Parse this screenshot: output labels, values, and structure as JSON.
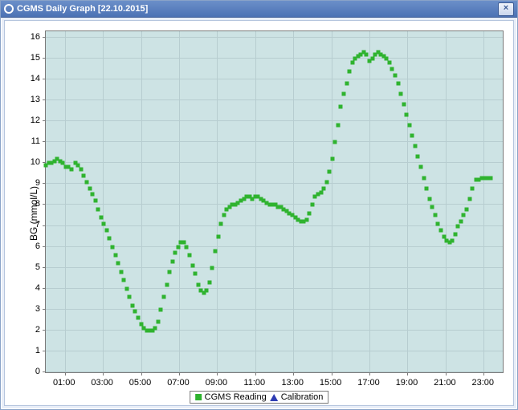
{
  "window": {
    "title": "CGMS Daily Graph [22.10.2015]",
    "close_label": "×"
  },
  "legend": {
    "series1": "CGMS Reading",
    "series2": "Calibration"
  },
  "chart_data": {
    "type": "scatter",
    "title": "",
    "xlabel": "",
    "ylabel": "BG (mmol/L)",
    "x_ticks": [
      "01:00",
      "03:00",
      "05:00",
      "07:00",
      "09:00",
      "11:00",
      "13:00",
      "15:00",
      "17:00",
      "19:00",
      "21:00",
      "23:00"
    ],
    "y_ticks": [
      0,
      1,
      2,
      3,
      4,
      5,
      6,
      7,
      8,
      9,
      10,
      11,
      12,
      13,
      14,
      15,
      16
    ],
    "xlim": [
      0,
      24
    ],
    "ylim": [
      0,
      16.3
    ],
    "series": [
      {
        "name": "CGMS Reading",
        "marker": "square",
        "color": "#2fb32f",
        "points": [
          [
            0.0,
            9.9
          ],
          [
            0.15,
            10.0
          ],
          [
            0.3,
            10.0
          ],
          [
            0.45,
            10.1
          ],
          [
            0.6,
            10.2
          ],
          [
            0.75,
            10.1
          ],
          [
            0.9,
            10.0
          ],
          [
            1.05,
            9.8
          ],
          [
            1.2,
            9.8
          ],
          [
            1.35,
            9.7
          ],
          [
            1.55,
            10.0
          ],
          [
            1.7,
            9.9
          ],
          [
            1.85,
            9.7
          ],
          [
            2.0,
            9.4
          ],
          [
            2.15,
            9.1
          ],
          [
            2.3,
            8.8
          ],
          [
            2.45,
            8.5
          ],
          [
            2.6,
            8.2
          ],
          [
            2.75,
            7.8
          ],
          [
            2.9,
            7.4
          ],
          [
            3.05,
            7.1
          ],
          [
            3.2,
            6.8
          ],
          [
            3.35,
            6.4
          ],
          [
            3.5,
            6.0
          ],
          [
            3.65,
            5.6
          ],
          [
            3.8,
            5.2
          ],
          [
            3.95,
            4.8
          ],
          [
            4.1,
            4.4
          ],
          [
            4.25,
            4.0
          ],
          [
            4.4,
            3.6
          ],
          [
            4.55,
            3.2
          ],
          [
            4.7,
            2.9
          ],
          [
            4.85,
            2.6
          ],
          [
            5.0,
            2.3
          ],
          [
            5.15,
            2.1
          ],
          [
            5.3,
            2.0
          ],
          [
            5.45,
            2.0
          ],
          [
            5.6,
            2.0
          ],
          [
            5.75,
            2.1
          ],
          [
            5.9,
            2.4
          ],
          [
            6.05,
            3.0
          ],
          [
            6.2,
            3.6
          ],
          [
            6.35,
            4.2
          ],
          [
            6.5,
            4.8
          ],
          [
            6.65,
            5.3
          ],
          [
            6.8,
            5.7
          ],
          [
            6.95,
            6.0
          ],
          [
            7.1,
            6.2
          ],
          [
            7.25,
            6.2
          ],
          [
            7.4,
            6.0
          ],
          [
            7.55,
            5.6
          ],
          [
            7.7,
            5.1
          ],
          [
            7.85,
            4.7
          ],
          [
            8.0,
            4.2
          ],
          [
            8.15,
            3.9
          ],
          [
            8.3,
            3.8
          ],
          [
            8.45,
            3.9
          ],
          [
            8.6,
            4.3
          ],
          [
            8.75,
            5.0
          ],
          [
            8.9,
            5.8
          ],
          [
            9.05,
            6.5
          ],
          [
            9.2,
            7.1
          ],
          [
            9.35,
            7.5
          ],
          [
            9.5,
            7.8
          ],
          [
            9.65,
            7.9
          ],
          [
            9.8,
            8.0
          ],
          [
            9.95,
            8.0
          ],
          [
            10.1,
            8.1
          ],
          [
            10.25,
            8.2
          ],
          [
            10.4,
            8.3
          ],
          [
            10.55,
            8.4
          ],
          [
            10.7,
            8.4
          ],
          [
            10.85,
            8.3
          ],
          [
            11.0,
            8.4
          ],
          [
            11.15,
            8.4
          ],
          [
            11.3,
            8.3
          ],
          [
            11.45,
            8.2
          ],
          [
            11.6,
            8.1
          ],
          [
            11.75,
            8.0
          ],
          [
            11.9,
            8.0
          ],
          [
            12.05,
            8.0
          ],
          [
            12.2,
            7.9
          ],
          [
            12.35,
            7.9
          ],
          [
            12.5,
            7.8
          ],
          [
            12.65,
            7.7
          ],
          [
            12.8,
            7.6
          ],
          [
            12.95,
            7.5
          ],
          [
            13.1,
            7.4
          ],
          [
            13.25,
            7.3
          ],
          [
            13.4,
            7.2
          ],
          [
            13.55,
            7.2
          ],
          [
            13.7,
            7.3
          ],
          [
            13.85,
            7.6
          ],
          [
            14.0,
            8.0
          ],
          [
            14.15,
            8.4
          ],
          [
            14.3,
            8.5
          ],
          [
            14.45,
            8.6
          ],
          [
            14.6,
            8.8
          ],
          [
            14.75,
            9.1
          ],
          [
            14.9,
            9.6
          ],
          [
            15.05,
            10.2
          ],
          [
            15.2,
            11.0
          ],
          [
            15.35,
            11.8
          ],
          [
            15.5,
            12.7
          ],
          [
            15.65,
            13.3
          ],
          [
            15.8,
            13.8
          ],
          [
            15.95,
            14.4
          ],
          [
            16.1,
            14.8
          ],
          [
            16.25,
            15.0
          ],
          [
            16.4,
            15.1
          ],
          [
            16.55,
            15.2
          ],
          [
            16.7,
            15.3
          ],
          [
            16.85,
            15.2
          ],
          [
            17.0,
            14.9
          ],
          [
            17.15,
            15.0
          ],
          [
            17.3,
            15.2
          ],
          [
            17.45,
            15.3
          ],
          [
            17.6,
            15.2
          ],
          [
            17.75,
            15.1
          ],
          [
            17.9,
            15.0
          ],
          [
            18.05,
            14.8
          ],
          [
            18.2,
            14.5
          ],
          [
            18.35,
            14.2
          ],
          [
            18.5,
            13.8
          ],
          [
            18.65,
            13.3
          ],
          [
            18.8,
            12.8
          ],
          [
            18.95,
            12.3
          ],
          [
            19.1,
            11.8
          ],
          [
            19.25,
            11.3
          ],
          [
            19.4,
            10.8
          ],
          [
            19.55,
            10.3
          ],
          [
            19.7,
            9.8
          ],
          [
            19.85,
            9.3
          ],
          [
            20.0,
            8.8
          ],
          [
            20.15,
            8.3
          ],
          [
            20.3,
            7.9
          ],
          [
            20.45,
            7.5
          ],
          [
            20.6,
            7.1
          ],
          [
            20.75,
            6.8
          ],
          [
            20.9,
            6.5
          ],
          [
            21.05,
            6.3
          ],
          [
            21.2,
            6.2
          ],
          [
            21.35,
            6.3
          ],
          [
            21.5,
            6.6
          ],
          [
            21.65,
            7.0
          ],
          [
            21.8,
            7.2
          ],
          [
            21.95,
            7.5
          ],
          [
            22.1,
            7.8
          ],
          [
            22.25,
            8.3
          ],
          [
            22.4,
            8.8
          ],
          [
            22.6,
            9.2
          ],
          [
            22.75,
            9.2
          ],
          [
            22.9,
            9.3
          ],
          [
            23.05,
            9.3
          ],
          [
            23.2,
            9.3
          ],
          [
            23.35,
            9.3
          ]
        ]
      },
      {
        "name": "Calibration",
        "marker": "triangle",
        "color": "#2f3db3",
        "points": []
      }
    ]
  }
}
